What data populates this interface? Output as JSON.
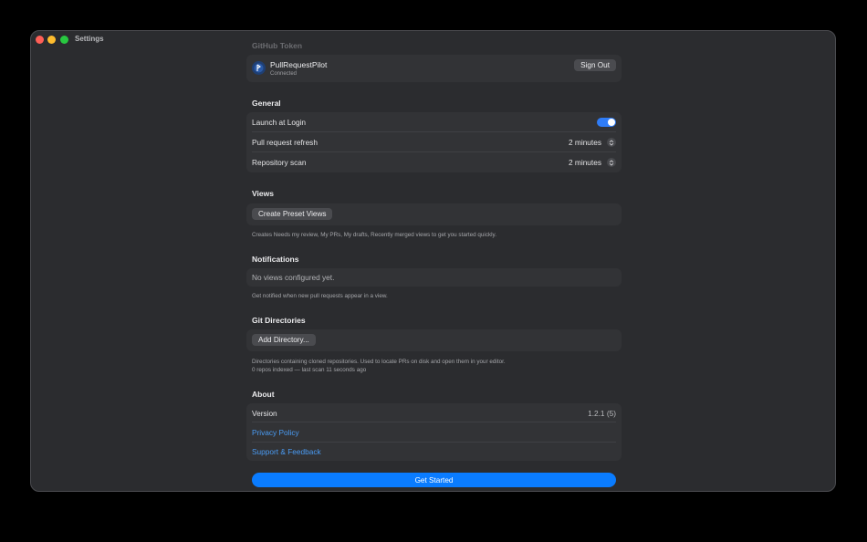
{
  "window": {
    "title": "Settings"
  },
  "github": {
    "section_title": "GitHub Token",
    "account_name": "PullRequestPilot",
    "account_status": "Connected",
    "sign_out_label": "Sign Out"
  },
  "general": {
    "section_title": "General",
    "launch_label": "Launch at Login",
    "launch_enabled": true,
    "pr_refresh_label": "Pull request refresh",
    "pr_refresh_value": "2 minutes",
    "repo_scan_label": "Repository scan",
    "repo_scan_value": "2 minutes"
  },
  "views": {
    "section_title": "Views",
    "create_button": "Create Preset Views",
    "note": "Creates Needs my review, My PRs, My drafts, Recently merged views to get you started quickly."
  },
  "notifications": {
    "section_title": "Notifications",
    "empty_text": "No views configured yet.",
    "note": "Get notified when new pull requests appear in a view."
  },
  "git_directories": {
    "section_title": "Git Directories",
    "add_button": "Add Directory...",
    "note_line1": "Directories containing cloned repositories. Used to locate PRs on disk and open them in your editor.",
    "note_line2": "0 repos indexed — last scan 11 seconds ago"
  },
  "about": {
    "section_title": "About",
    "version_label": "Version",
    "version_value": "1.2.1 (5)",
    "privacy_link": "Privacy Policy",
    "support_link": "Support & Feedback"
  },
  "footer": {
    "get_started_label": "Get Started"
  },
  "colors": {
    "accent": "#0a7cff",
    "link": "#4a9cf5",
    "window_bg": "#2b2c2f",
    "card_bg": "#323336"
  }
}
